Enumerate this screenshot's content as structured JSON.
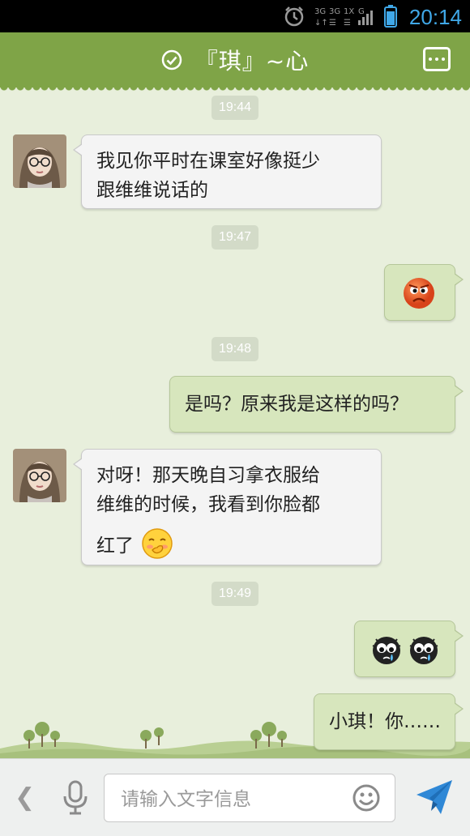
{
  "status_bar": {
    "time": "20:14",
    "network": [
      "3G",
      "3G",
      "1X",
      "G"
    ],
    "icons": [
      "alarm-icon",
      "signal-icon",
      "battery-icon"
    ]
  },
  "header": {
    "title": "『琪』~心",
    "status_icon": "online-check-icon",
    "menu_icon": "more-icon"
  },
  "messages": [
    {
      "type": "time",
      "text": "19:44"
    },
    {
      "type": "received",
      "text_lines": [
        "我见你平时在课室好像挺少",
        "跟维维说话的"
      ]
    },
    {
      "type": "time",
      "text": "19:47"
    },
    {
      "type": "sent",
      "emoji": [
        "angry-face-emoji"
      ]
    },
    {
      "type": "time",
      "text": "19:48"
    },
    {
      "type": "sent",
      "text": "是吗？原来我是这样的吗？"
    },
    {
      "type": "received",
      "text_lines": [
        "对呀！那天晚自习拿衣服给",
        "维维的时候，我看到你脸都",
        "红了"
      ],
      "emoji": [
        "shy-face-emoji"
      ]
    },
    {
      "type": "time",
      "text": "19:49"
    },
    {
      "type": "sent",
      "emoji": [
        "crying-bug-emoji",
        "crying-bug-emoji"
      ]
    },
    {
      "type": "sent",
      "text": "小琪！你……"
    }
  ],
  "input": {
    "placeholder": "请输入文字信息",
    "value": ""
  },
  "colors": {
    "header": "#7fa447",
    "background": "#e8efdc",
    "sent_bubble": "#d7e6bd",
    "received_bubble": "#f4f4f4",
    "status_accent": "#40a8e8",
    "send_button": "#2f88d6"
  }
}
